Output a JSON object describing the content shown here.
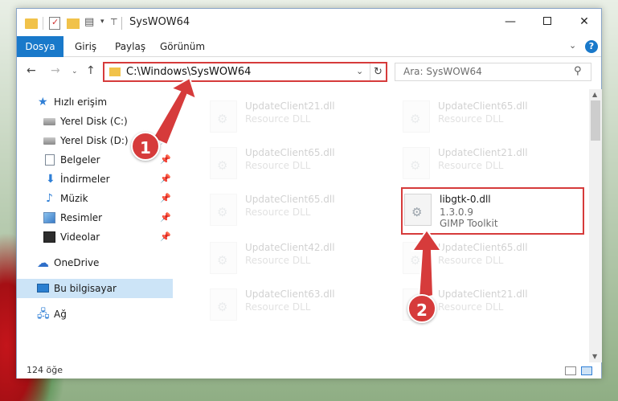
{
  "window": {
    "title": "SysWOW64",
    "controls": {
      "minimize": "—",
      "maximize": "",
      "close": "✕"
    }
  },
  "ribbon": {
    "tabs": [
      "Dosya",
      "Giriş",
      "Paylaş",
      "Görünüm"
    ],
    "collapse_icon": "⌄",
    "help_icon": "?"
  },
  "nav": {
    "back": "←",
    "forward": "→",
    "recent": "⌄",
    "up": "↑",
    "address": "C:\\Windows\\SysWOW64",
    "address_dropdown": "⌄",
    "refresh": "↻",
    "search_placeholder": "Ara: SysWOW64",
    "search_icon": "⚲"
  },
  "sidebar": {
    "items": [
      {
        "label": "Hızlı erişim",
        "icon": "star-icon",
        "pinned": false
      },
      {
        "label": "Yerel Disk (C:)",
        "icon": "disk-icon",
        "pinned": false
      },
      {
        "label": "Yerel Disk (D:)",
        "icon": "disk-icon",
        "pinned": true
      },
      {
        "label": "Belgeler",
        "icon": "documents-icon",
        "pinned": true
      },
      {
        "label": "İndirmeler",
        "icon": "downloads-icon",
        "pinned": true
      },
      {
        "label": "Müzik",
        "icon": "music-icon",
        "pinned": true
      },
      {
        "label": "Resimler",
        "icon": "pictures-icon",
        "pinned": true
      },
      {
        "label": "Videolar",
        "icon": "videos-icon",
        "pinned": true
      },
      {
        "label": "OneDrive",
        "icon": "cloud-icon",
        "pinned": false
      },
      {
        "label": "Bu bilgisayar",
        "icon": "computer-icon",
        "pinned": false,
        "selected": true
      },
      {
        "label": "Ağ",
        "icon": "network-icon",
        "pinned": false
      }
    ],
    "pin_glyph": "📌"
  },
  "files": [
    {
      "name": "UpdateClient21.dll",
      "desc": "Resource DLL",
      "faded": true
    },
    {
      "name": "UpdateClient65.dll",
      "desc": "Resource DLL",
      "faded": true
    },
    {
      "name": "UpdateClient65.dll",
      "desc": "Resource DLL",
      "faded": true
    },
    {
      "name": "UpdateClient21.dll",
      "desc": "Resource DLL",
      "faded": true
    },
    {
      "name": "UpdateClient65.dll",
      "desc": "Resource DLL",
      "faded": true
    },
    {
      "name": "libgtk-0.dll",
      "version": "1.3.0.9",
      "company": "GIMP Toolkit",
      "faded": false,
      "highlighted": true
    },
    {
      "name": "UpdateClient42.dll",
      "desc": "Resource DLL",
      "faded": true
    },
    {
      "name": "UpdateClient65.dll",
      "desc": "Resource DLL",
      "faded": true
    },
    {
      "name": "UpdateClient63.dll",
      "desc": "Resource DLL",
      "faded": true
    },
    {
      "name": "UpdateClient21.dll",
      "desc": "Resource DLL",
      "faded": true
    }
  ],
  "status": {
    "item_count": "124 öğe"
  },
  "annotations": {
    "step1": "1",
    "step2": "2",
    "highlight_color": "#d63b3b"
  },
  "colors": {
    "accent": "#1979ca",
    "selection": "#cce4f7",
    "annotation": "#d63b3b"
  }
}
